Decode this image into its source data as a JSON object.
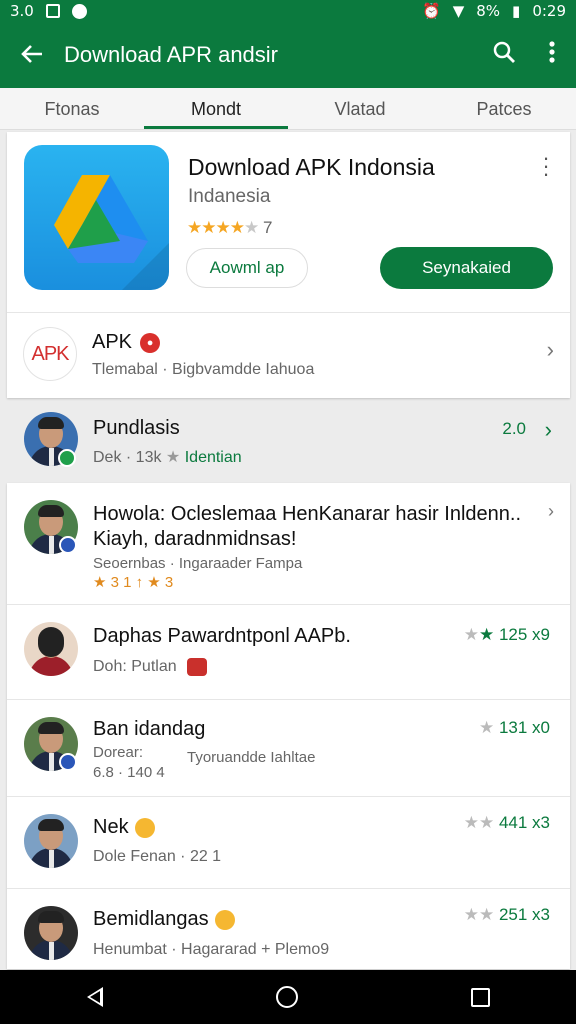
{
  "status_bar": {
    "left_text": "3.0",
    "battery": "8%",
    "time": "0:29"
  },
  "app_bar": {
    "title": "Download APR andsir"
  },
  "tabs": [
    {
      "label": "Ftonas"
    },
    {
      "label": "Mondt"
    },
    {
      "label": "Vlatad"
    },
    {
      "label": "Patces"
    }
  ],
  "hero": {
    "title": "Download APK Indonsia",
    "subtitle": "Indanesia",
    "rating_count": "7",
    "btn_secondary": "Aowml ap",
    "btn_primary": "Seynakaied"
  },
  "apk_row": {
    "logo_text": "APK",
    "title": "APK",
    "subtitle": "Tlemabal · Bigbvamdde Iahuoa"
  },
  "featured_row": {
    "title": "Pundlasis",
    "sub_left": "Dek · 13k ",
    "sub_green": "Identian",
    "count": "2.0"
  },
  "list": [
    {
      "title_1": "Howola: Ocleslemaa HenKanarar hasir Inldenn..",
      "title_2": "Kiayh, daradnmidnsas!",
      "subtitle": "Seoernbas · Ingaraader Fampa",
      "meta": "★ 3 1 ↑ ★ 3"
    },
    {
      "title": "Daphas Pawardntponl AAPb.",
      "subtitle": "Doh: Putlan",
      "count": "125 x9"
    },
    {
      "title": "Ban idandag",
      "subtitle_1": "Dorear:",
      "subtitle_2": "Tyoruandde Iahltae",
      "meta": "6.8 · 140 4",
      "count": "131 x0"
    },
    {
      "title": "Nek",
      "subtitle": "Dole Fenan · 22 1",
      "count": "441 x3"
    },
    {
      "title": "Bemidlangas",
      "subtitle": "Henumbat · Hagararad + Plemo9",
      "count": "251 x3"
    }
  ]
}
